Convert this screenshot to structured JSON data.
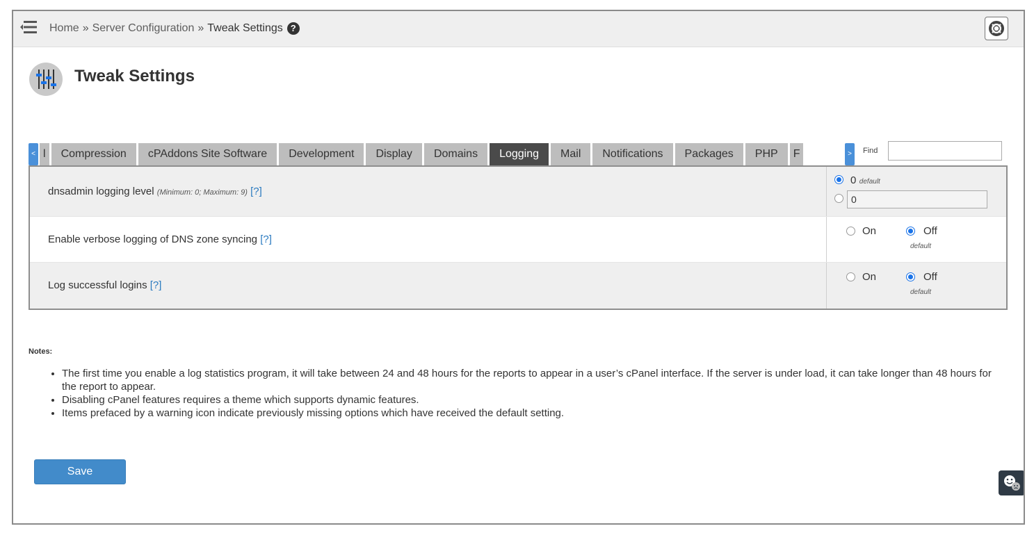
{
  "breadcrumb": {
    "home": "Home",
    "separator": "»",
    "section": "Server Configuration",
    "current": "Tweak Settings",
    "help_glyph": "?"
  },
  "icons": {
    "menu": "menu-collapse-icon",
    "help": "question-circle-icon",
    "support": "lifebuoy-icon",
    "page": "sliders-icon",
    "feedback": "smiley-feedback-icon"
  },
  "page": {
    "title": "Tweak Settings"
  },
  "tabs": {
    "scroll_left": "<",
    "scroll_right": ">",
    "partial_first": "l",
    "items": [
      {
        "label": "Compression"
      },
      {
        "label": "cPAddons Site Software"
      },
      {
        "label": "Development"
      },
      {
        "label": "Display"
      },
      {
        "label": "Domains"
      },
      {
        "label": "Logging"
      },
      {
        "label": "Mail"
      },
      {
        "label": "Notifications"
      },
      {
        "label": "Packages"
      },
      {
        "label": "PHP"
      }
    ],
    "partial_last": "F",
    "active": "Logging"
  },
  "find": {
    "label": "Find",
    "value": ""
  },
  "settings": [
    {
      "label": "dnsadmin logging level",
      "hint": "(Minimum: 0; Maximum: 9)",
      "help": "[?]",
      "option_default_value": "0",
      "default_tag": "default",
      "custom_value": "0",
      "selected": "default"
    },
    {
      "label": "Enable verbose logging of DNS zone syncing",
      "help": "[?]",
      "on_label": "On",
      "off_label": "Off",
      "default_tag": "default",
      "selected": "Off"
    },
    {
      "label": "Log successful logins",
      "help": "[?]",
      "on_label": "On",
      "off_label": "Off",
      "default_tag": "default",
      "selected": "Off"
    }
  ],
  "notes": {
    "title": "Notes:",
    "items": [
      "The first time you enable a log statistics program, it will take between 24 and 48 hours for the reports to appear in a user’s cPanel interface. If the server is under load, it can take longer than 48 hours for the report to appear.",
      "Disabling cPanel features requires a theme which supports dynamic features.",
      "Items prefaced by a warning icon indicate previously missing options which have received the default setting."
    ]
  },
  "actions": {
    "save": "Save"
  },
  "colors": {
    "accent": "#428bca",
    "active_tab": "#4a4a4a",
    "tab": "#bdbdbd",
    "radio_checked": "#1a73e8",
    "link": "#2a7ac0"
  }
}
